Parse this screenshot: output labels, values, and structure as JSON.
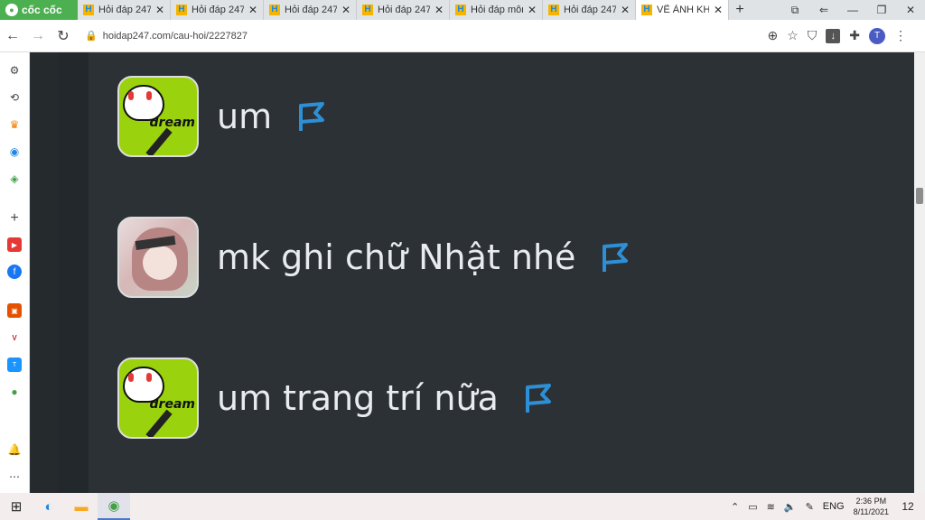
{
  "browser": {
    "brand": "cốc cốc",
    "tabs": [
      {
        "title": "Hỏi đáp 247",
        "active": false
      },
      {
        "title": "Hỏi đáp 247",
        "active": false
      },
      {
        "title": "Hỏi đáp 247",
        "active": false
      },
      {
        "title": "Hỏi đáp 247",
        "active": false
      },
      {
        "title": "Hỏi đáp môn",
        "active": false
      },
      {
        "title": "Hỏi đáp 247",
        "active": false
      },
      {
        "title": "VẼ ẢNH KHA",
        "active": true
      }
    ],
    "new_tab": "+",
    "url": "hoidap247.com/cau-hoi/2227827",
    "profile_initial": "T"
  },
  "chat": {
    "messages": [
      {
        "text": "um",
        "avatar": "dream-avatar",
        "avatar_text": "dream"
      },
      {
        "text": "mk ghi chữ Nhật nhé",
        "avatar": "anime-avatar"
      },
      {
        "text": "um trang trí nữa",
        "avatar": "dream-avatar",
        "avatar_text": "dream"
      }
    ],
    "flag_color": "#2d8fd6"
  },
  "taskbar": {
    "language": "ENG",
    "time": "2:36 PM",
    "date": "8/11/2021",
    "notification_count": "12"
  },
  "colors": {
    "background": "#2b3135",
    "brand_green": "#4caf50",
    "avatar_green": "#9ad30e"
  }
}
